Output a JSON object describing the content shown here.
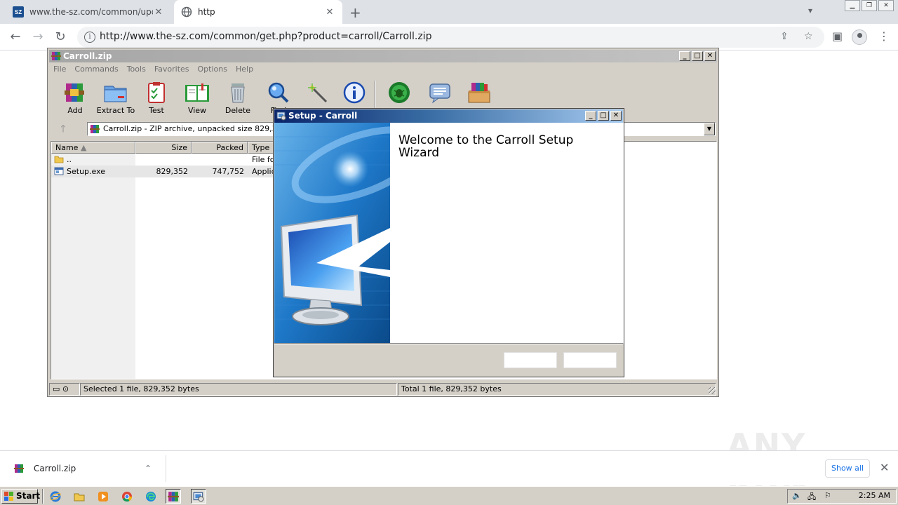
{
  "browser": {
    "tabs": [
      {
        "title": "www.the-sz.com/common/update.ph",
        "favicon_text": "SZ",
        "active": false
      },
      {
        "title": "http",
        "active": true
      }
    ],
    "new_tab_symbol": "+",
    "tab_list_symbol": "⌄",
    "window_controls": [
      "‒",
      "❐",
      "✕"
    ],
    "url": "http://www.the-sz.com/common/get.php?product=carroll/Carroll.zip",
    "nav": {
      "back": "←",
      "forward": "→",
      "reload": "↻"
    },
    "icons": [
      "share-icon",
      "star-icon",
      "side-panel-icon",
      "profile-icon",
      "menu-icon"
    ]
  },
  "winrar": {
    "title": "Carroll.zip",
    "menu": [
      "File",
      "Commands",
      "Tools",
      "Favorites",
      "Options",
      "Help"
    ],
    "toolbar": [
      {
        "label": "Add",
        "icon": "add-archive-icon"
      },
      {
        "label": "Extract To",
        "icon": "extract-folder-icon"
      },
      {
        "label": "Test",
        "icon": "test-clipboard-icon"
      },
      {
        "label": "View",
        "icon": "view-book-icon"
      },
      {
        "label": "Delete",
        "icon": "trash-icon"
      },
      {
        "label": "Find",
        "icon": "find-magnifier-icon"
      },
      {
        "label": "",
        "icon": "wizard-wand-icon"
      },
      {
        "label": "",
        "icon": "info-icon"
      },
      {
        "label": "",
        "icon": "virus-scan-icon"
      },
      {
        "label": "",
        "icon": "comment-icon"
      },
      {
        "label": "",
        "icon": "sfx-box-icon"
      }
    ],
    "address": "Carroll.zip - ZIP archive, unpacked size 829,352 bytes",
    "columns": [
      "Name",
      "Size",
      "Packed",
      "Type"
    ],
    "rows": [
      {
        "name": "..",
        "size": "",
        "packed": "",
        "type": "File folder",
        "icon": "folder-icon"
      },
      {
        "name": "Setup.exe",
        "size": "829,352",
        "packed": "747,752",
        "type": "Application",
        "icon": "exe-icon"
      }
    ],
    "status_left": "Selected 1 file, 829,352 bytes",
    "status_right": "Total 1 file, 829,352 bytes"
  },
  "setup": {
    "title": "Setup - Carroll",
    "heading": "Welcome to the Carroll Setup Wizard",
    "buttons": [
      "",
      ""
    ]
  },
  "download": {
    "file": "Carroll.zip",
    "chevron": "⌃",
    "show_all": "Show all",
    "close": "✕"
  },
  "watermark": "ANY RUN",
  "taskbar": {
    "start": "Start",
    "time": "2:25 AM",
    "apps": [
      "ie-icon",
      "explorer-icon",
      "media-player-icon",
      "chrome-icon",
      "edge-icon",
      "winrar-icon",
      "setup-icon"
    ]
  },
  "colors": {
    "title_active": "#0a246a",
    "title_gradient_end": "#a6caf0",
    "chrome_tabstrip": "#dee1e6",
    "link_blue": "#1a73e8"
  }
}
